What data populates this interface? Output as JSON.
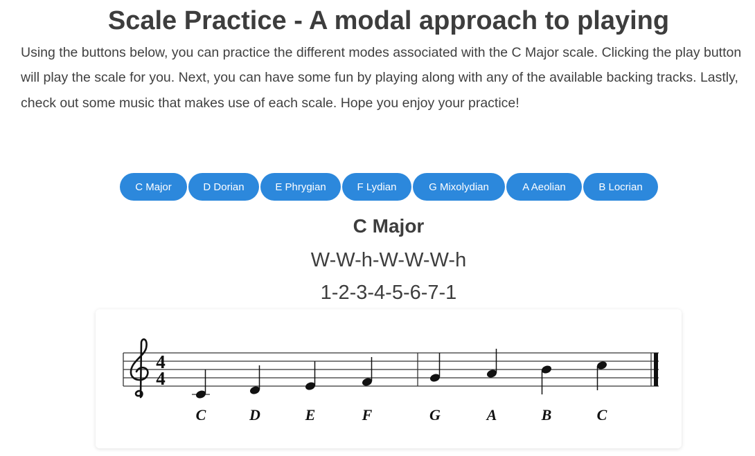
{
  "page": {
    "title": "Scale Practice - A modal approach to playing",
    "intro": "Using the buttons below, you can practice the different modes associated with the C Major scale. Clicking the play button will play the scale for you. Next, you can have some fun by playing along with any of the available backing tracks. Lastly, check out some music that makes use of each scale. Hope you enjoy your practice!"
  },
  "modes": [
    {
      "label": "C Major"
    },
    {
      "label": "D Dorian"
    },
    {
      "label": "E Phrygian"
    },
    {
      "label": "F Lydian"
    },
    {
      "label": "G Mixolydian"
    },
    {
      "label": "A Aeolian"
    },
    {
      "label": "B Locrian"
    }
  ],
  "selected_scale": {
    "name": "C Major",
    "steps": "W-W-h-W-W-W-h",
    "degrees": "1-2-3-4-5-6-7-1"
  },
  "notation": {
    "time_signature": {
      "top": "4",
      "bottom": "4"
    },
    "clef": "treble-clef-icon",
    "notes": [
      "C",
      "D",
      "E",
      "F",
      "G",
      "A",
      "B",
      "C"
    ]
  },
  "colors": {
    "button_bg": "#2c88dc",
    "button_text": "#ffffff",
    "text": "#3d3d3d"
  }
}
